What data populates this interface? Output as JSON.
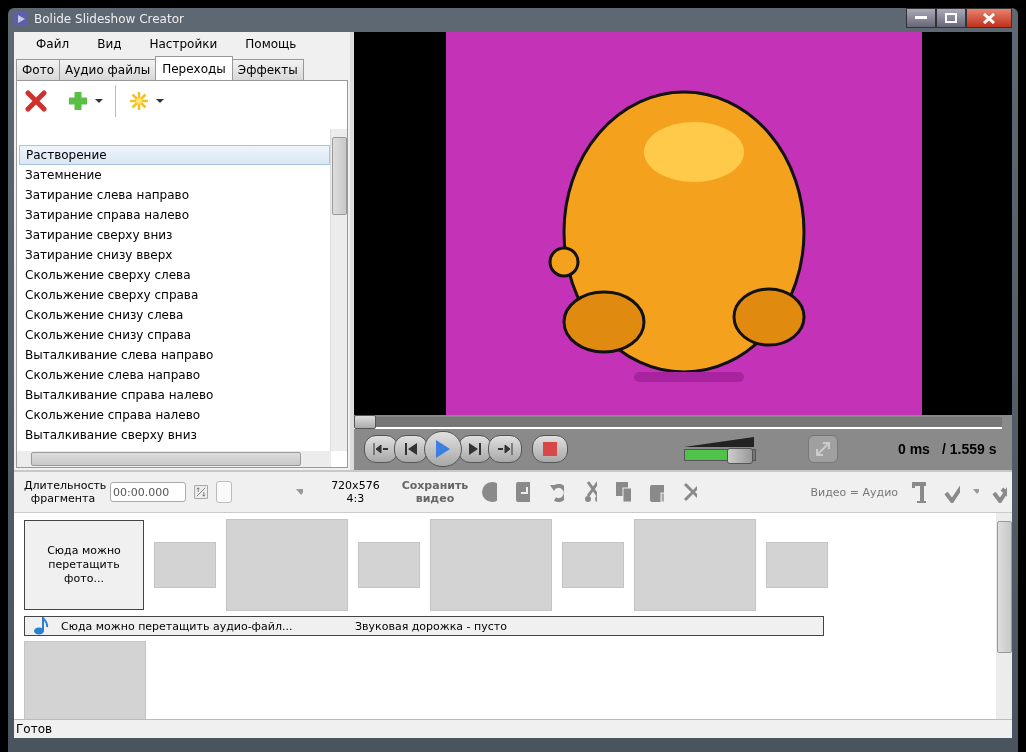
{
  "window": {
    "title": "Bolide Slideshow Creator"
  },
  "menu": [
    "Файл",
    "Вид",
    "Настройки",
    "Помощь"
  ],
  "tabs": [
    {
      "label": "Фото",
      "selected": false
    },
    {
      "label": "Аудио файлы",
      "selected": false
    },
    {
      "label": "Переходы",
      "selected": true
    },
    {
      "label": "Эффекты",
      "selected": false
    }
  ],
  "transitions": [
    {
      "label": "Растворение",
      "selected": true
    },
    {
      "label": "Затемнение",
      "selected": false
    },
    {
      "label": "Затирание слева направо",
      "selected": false
    },
    {
      "label": "Затирание справа налево",
      "selected": false
    },
    {
      "label": "Затирание сверху вниз",
      "selected": false
    },
    {
      "label": "Затирание снизу вверх",
      "selected": false
    },
    {
      "label": "Скольжение сверху слева",
      "selected": false
    },
    {
      "label": "Скольжение сверху справа",
      "selected": false
    },
    {
      "label": "Скольжение снизу слева",
      "selected": false
    },
    {
      "label": "Скольжение снизу справа",
      "selected": false
    },
    {
      "label": "Выталкивание слева направо",
      "selected": false
    },
    {
      "label": "Скольжение слева направо",
      "selected": false
    },
    {
      "label": "Выталкивание справа налево",
      "selected": false
    },
    {
      "label": "Скольжение справа налево",
      "selected": false
    },
    {
      "label": "Выталкивание сверху вниз",
      "selected": false
    }
  ],
  "player": {
    "position": {
      "level": 0
    },
    "volume": {
      "level": 0.6
    },
    "time": "0 ms",
    "duration": "/ 1.559 s"
  },
  "fragment_bar": {
    "duration_label": "Длительность фрагмента",
    "duration_value": "00:00.000",
    "resolution": "720x576",
    "aspect": "4:3",
    "save_button": "Сохранить видео",
    "sync_label": "Видео = Аудио"
  },
  "timeline": {
    "photo_drop_hint": "Сюда можно перетащить фото...",
    "slots": [
      {
        "kind": "transition"
      },
      {
        "kind": "slide"
      },
      {
        "kind": "transition"
      },
      {
        "kind": "slide"
      },
      {
        "kind": "transition"
      },
      {
        "kind": "slide"
      },
      {
        "kind": "transition"
      }
    ],
    "audio_drop_hint": "Сюда можно перетащить аудио-файл...",
    "audio_track": "Звуковая дорожка - пусто",
    "second_row": [
      {
        "kind": "slide"
      }
    ]
  },
  "status_bar": "Готов"
}
